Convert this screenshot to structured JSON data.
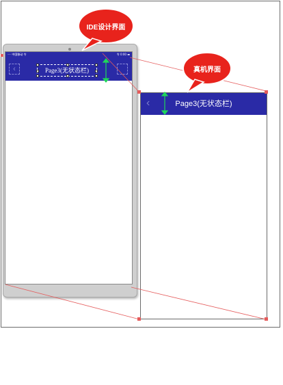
{
  "callouts": {
    "ide_label": "IDE设计界面",
    "device_label": "真机界面"
  },
  "ide": {
    "status_left": "ᐧᐧᐧᐧᐧ  中国移动  令",
    "status_right": "令 0:00  ▬",
    "back_glyph": "‹",
    "title": "Page3(无状态栏)"
  },
  "device": {
    "back_glyph": "‹",
    "title": "Page3(无状态栏)"
  },
  "colors": {
    "navbar": "#2a2aa6",
    "callout": "#e8231c",
    "measure": "#1fd65a",
    "guide": "#e55c5c"
  }
}
